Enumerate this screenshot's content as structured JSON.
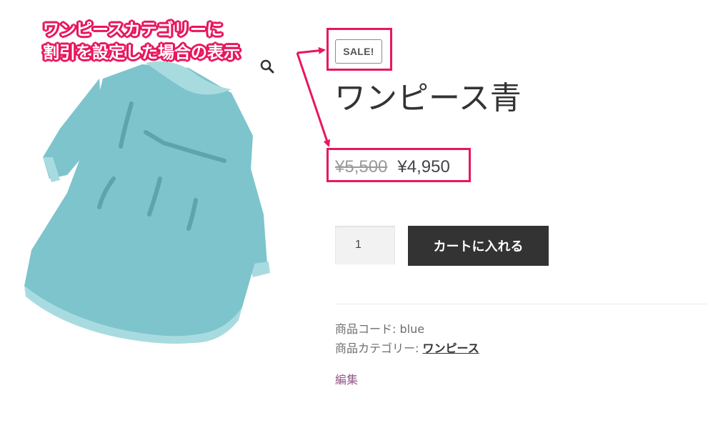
{
  "annotation": {
    "line1": "ワンピースカテゴリーに",
    "line2": "割引を設定した場合の表示",
    "color": "#e8175d"
  },
  "product": {
    "sale_badge": "SALE!",
    "title": "ワンピース青",
    "price_old": "¥5,500",
    "price_new": "¥4,950",
    "quantity": "1",
    "add_to_cart_label": "カートに入れる",
    "sku_label": "商品コード:",
    "sku_value": "blue",
    "category_label": "商品カテゴリー:",
    "category_value": "ワンピース",
    "edit_label": "編集",
    "zoom_icon": "magnifier-icon",
    "dress_color": "#7ec4cc"
  }
}
